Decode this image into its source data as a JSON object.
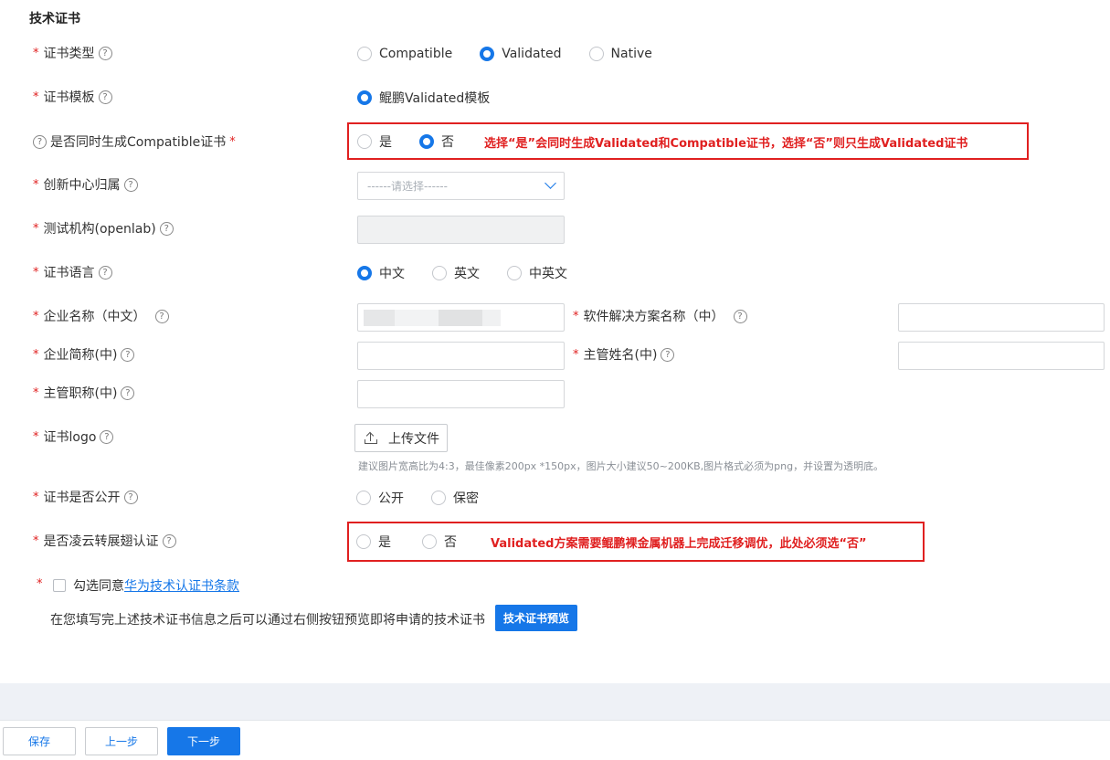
{
  "section_title": "技术证书",
  "required_mark": "*",
  "help_glyph": "?",
  "fields": {
    "cert_type": {
      "label": "证书类型",
      "options": [
        {
          "label": "Compatible",
          "selected": false
        },
        {
          "label": "Validated",
          "selected": true
        },
        {
          "label": "Native",
          "selected": false
        }
      ]
    },
    "cert_template": {
      "label": "证书模板",
      "options": [
        {
          "label": "鲲鹏Validated模板",
          "selected": true
        }
      ]
    },
    "gen_compatible": {
      "label": "是否同时生成Compatible证书",
      "options": [
        {
          "label": "是",
          "selected": false
        },
        {
          "label": "否",
          "selected": true
        }
      ],
      "annotation": "选择“是”会同时生成Validated和Compatible证书，选择“否”则只生成Validated证书"
    },
    "innovation_center": {
      "label": "创新中心归属",
      "placeholder": "------请选择------"
    },
    "test_org": {
      "label": "测试机构(openlab)"
    },
    "cert_language": {
      "label": "证书语言",
      "options": [
        {
          "label": "中文",
          "selected": true
        },
        {
          "label": "英文",
          "selected": false
        },
        {
          "label": "中英文",
          "selected": false
        }
      ]
    },
    "company_name": {
      "label": "企业名称（中文）"
    },
    "solution_name": {
      "label": "软件解决方案名称（中）"
    },
    "company_short": {
      "label": "企业简称(中)"
    },
    "manager_name": {
      "label": "主管姓名(中)"
    },
    "manager_title": {
      "label": "主管职称(中)"
    },
    "cert_logo": {
      "label": "证书logo",
      "upload_label": "上传文件",
      "hint": "建议图片宽高比为4:3，最佳像素200px *150px，图片大小建议50~200KB,图片格式必须为png，并设置为透明底。"
    },
    "cert_public": {
      "label": "证书是否公开",
      "options": [
        {
          "label": "公开",
          "selected": false
        },
        {
          "label": "保密",
          "selected": false
        }
      ]
    },
    "lingyun": {
      "label": "是否凌云转展翅认证",
      "options": [
        {
          "label": "是",
          "selected": false
        },
        {
          "label": "否",
          "selected": false
        }
      ],
      "annotation": "Validated方案需要鲲鹏裸金属机器上完成迁移调优，此处必须选“否”"
    }
  },
  "agreement": {
    "prefix": "勾选同意",
    "link": "华为技术认证书条款"
  },
  "preview": {
    "text": "在您填写完上述技术证书信息之后可以通过右侧按钮预览即将申请的技术证书",
    "button": "技术证书预览"
  },
  "footer": {
    "save": "保存",
    "prev": "上一步",
    "next": "下一步"
  },
  "colors": {
    "accent": "#1677e8",
    "required": "#e02020",
    "annotation": "#e02020"
  }
}
